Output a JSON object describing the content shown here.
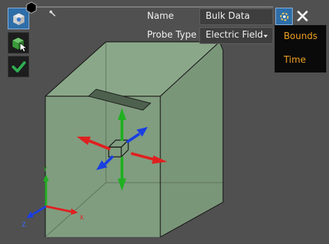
{
  "form": {
    "name_label": "Name",
    "name_value": "Bulk Data",
    "probe_type_label": "Probe Type",
    "probe_type_value": "Electric Field"
  },
  "popup_menu": {
    "items": [
      "Bounds",
      "Time"
    ]
  },
  "axes": {
    "y_label": "Y",
    "z_label": "Z",
    "x_label": "X"
  },
  "icons": {
    "top_toolbar": [
      "probe-cube-icon",
      "select-cursor-icon",
      "checkmark-icon"
    ],
    "form_side": [
      "gear-icon",
      "close-icon"
    ],
    "badge": "hexagon-icon",
    "pin": "pin-icon"
  },
  "colors": {
    "background": "#505050",
    "box_fill": "#7f9b7e",
    "box_edge": "#1a1a1a",
    "x_axis": "#e02020",
    "y_axis": "#20b020",
    "z_axis": "#1a3fe0",
    "menu_text": "#f0a020",
    "active_tool": "#2e6ea8"
  }
}
